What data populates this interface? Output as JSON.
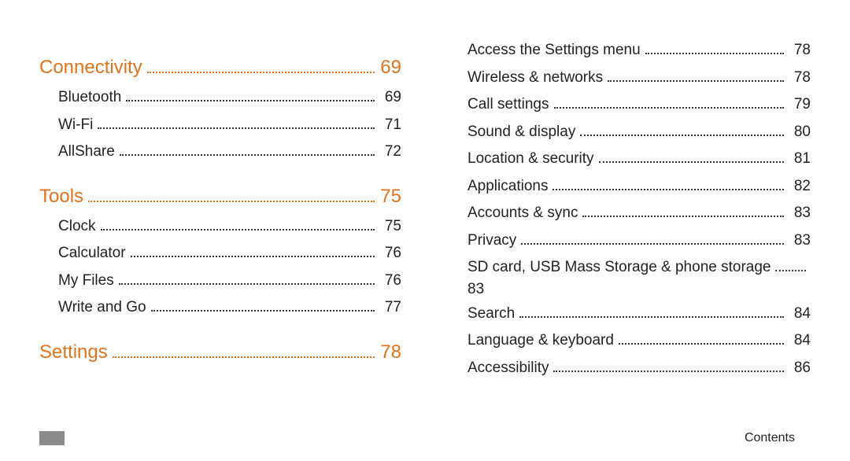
{
  "left": {
    "sections": [
      {
        "title": "Connectivity",
        "page": "69",
        "items": [
          {
            "label": "Bluetooth",
            "page": "69"
          },
          {
            "label": "Wi-Fi",
            "page": "71"
          },
          {
            "label": "AllShare",
            "page": "72"
          }
        ]
      },
      {
        "title": "Tools",
        "page": "75",
        "items": [
          {
            "label": "Clock",
            "page": "75"
          },
          {
            "label": "Calculator",
            "page": "76"
          },
          {
            "label": "My Files",
            "page": "76"
          },
          {
            "label": "Write and Go",
            "page": "77"
          }
        ]
      },
      {
        "title": "Settings",
        "page": "78",
        "items": []
      }
    ]
  },
  "right": {
    "items": [
      {
        "label": "Access the Settings menu",
        "page": "78"
      },
      {
        "label": "Wireless & networks",
        "page": "78"
      },
      {
        "label": "Call settings",
        "page": "79"
      },
      {
        "label": "Sound & display",
        "page": "80"
      },
      {
        "label": "Location & security",
        "page": "81"
      },
      {
        "label": "Applications",
        "page": "82"
      },
      {
        "label": "Accounts & sync",
        "page": "83"
      },
      {
        "label": "Privacy",
        "page": "83"
      },
      {
        "label": "SD card, USB Mass Storage & phone storage",
        "page": "83",
        "wrap": true
      },
      {
        "label": "Search",
        "page": "84"
      },
      {
        "label": "Language & keyboard",
        "page": "84"
      },
      {
        "label": "Accessibility",
        "page": "86"
      }
    ]
  },
  "footer": "Contents"
}
